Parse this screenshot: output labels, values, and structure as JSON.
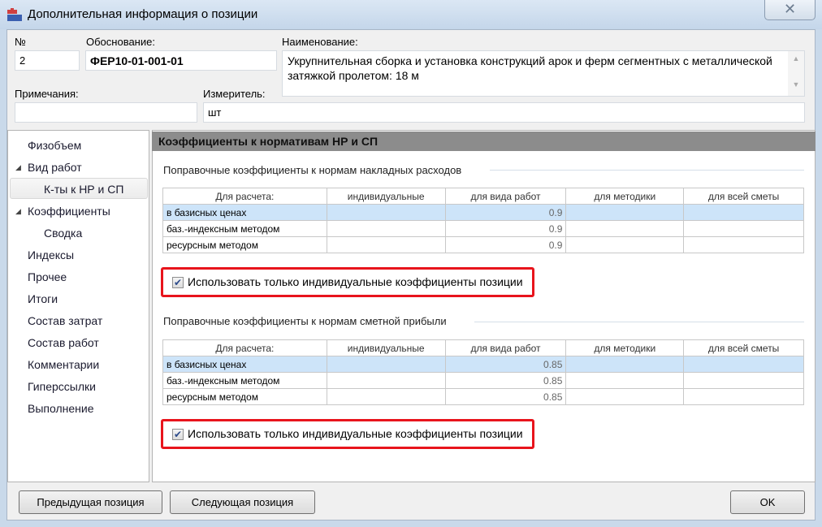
{
  "window": {
    "title": "Дополнительная информация о позиции",
    "close_icon": "close-icon"
  },
  "fields": {
    "number_label": "№",
    "number_value": "2",
    "basis_label": "Обоснование:",
    "basis_value": "ФЕР10-01-001-01",
    "name_label": "Наименование:",
    "name_value": "Укрупнительная сборка и установка конструкций арок и ферм сегментных с металлической затяжкой пролетом: 18 м",
    "notes_label": "Примечания:",
    "notes_value": "",
    "unit_label": "Измеритель:",
    "unit_value": "шт"
  },
  "tree": {
    "items": [
      "Физобъем",
      "Вид работ",
      "К-ты к НР и СП",
      "Коэффициенты",
      "Сводка",
      "Индексы",
      "Прочее",
      "Итоги",
      "Состав затрат",
      "Состав работ",
      "Комментарии",
      "Гиперссылки",
      "Выполнение"
    ]
  },
  "panel": {
    "header": "Коэффициенты к нормативам НР и СП",
    "columns": [
      "Для расчета:",
      "индивидуальные",
      "для вида работ",
      "для методики",
      "для всей сметы"
    ],
    "overhead": {
      "title": "Поправочные коэффициенты к нормам накладных расходов",
      "rows": [
        [
          "в базисных ценах",
          "",
          "0.9",
          "",
          ""
        ],
        [
          "баз.-индексным методом",
          "",
          "0.9",
          "",
          ""
        ],
        [
          "ресурсным методом",
          "",
          "0.9",
          "",
          ""
        ]
      ],
      "checkbox_label": "Использовать только индивидуальные коэффициенты позиции",
      "checked": true
    },
    "profit": {
      "title": "Поправочные коэффициенты к нормам сметной прибыли",
      "rows": [
        [
          "в базисных ценах",
          "",
          "0.85",
          "",
          ""
        ],
        [
          "баз.-индексным методом",
          "",
          "0.85",
          "",
          ""
        ],
        [
          "ресурсным методом",
          "",
          "0.85",
          "",
          ""
        ]
      ],
      "checkbox_label": "Использовать только индивидуальные коэффициенты позиции",
      "checked": true
    }
  },
  "buttons": {
    "prev": "Предыдущая позиция",
    "next": "Следующая позиция",
    "ok": "OK"
  },
  "colors": {
    "highlight": "#e8141c",
    "selected_row": "#cde4f9"
  }
}
